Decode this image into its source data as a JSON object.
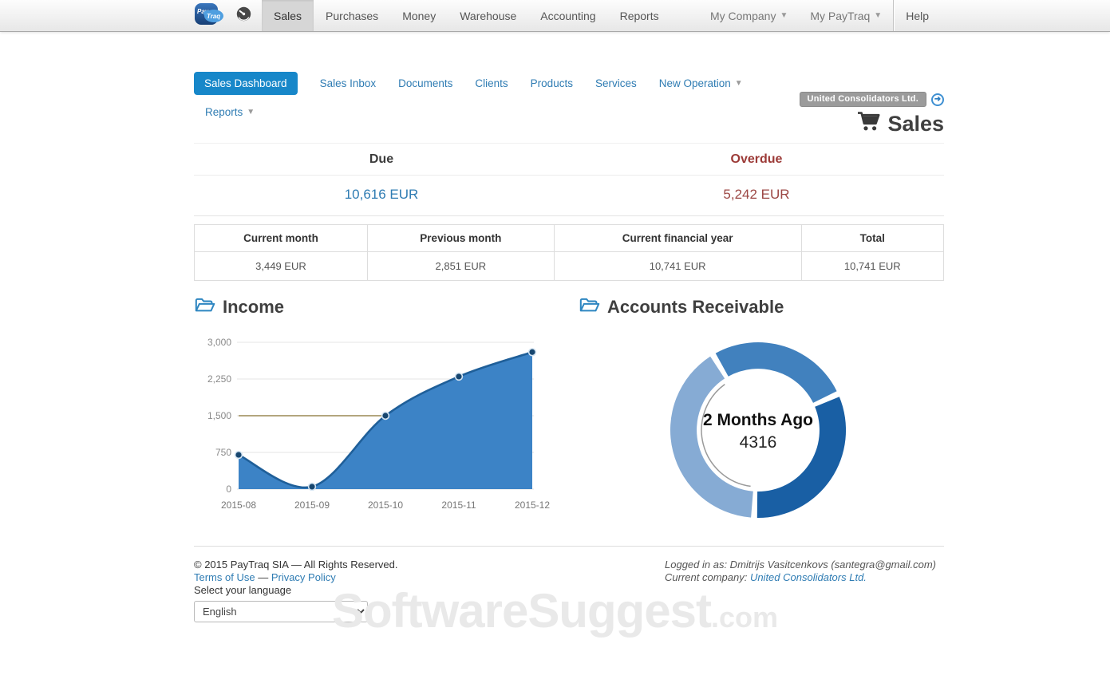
{
  "nav": {
    "brand": "PayTraq",
    "items": [
      {
        "label": "Sales"
      },
      {
        "label": "Purchases"
      },
      {
        "label": "Money"
      },
      {
        "label": "Warehouse"
      },
      {
        "label": "Accounting"
      },
      {
        "label": "Reports"
      }
    ],
    "my_company": "My Company",
    "my_paytraq": "My PayTraq",
    "help": "Help"
  },
  "header": {
    "company_badge": "United Consolidators Ltd.",
    "title": "Sales"
  },
  "tabs": {
    "items": [
      {
        "label": "Sales Dashboard"
      },
      {
        "label": "Sales Inbox"
      },
      {
        "label": "Documents"
      },
      {
        "label": "Clients"
      },
      {
        "label": "Products"
      },
      {
        "label": "Services"
      },
      {
        "label": "New Operation"
      },
      {
        "label": "Reports"
      }
    ]
  },
  "summary": {
    "due_label": "Due",
    "due_value": "10,616 EUR",
    "overdue_label": "Overdue",
    "overdue_value": "5,242 EUR"
  },
  "stats_table": {
    "headers": [
      "Current month",
      "Previous month",
      "Current financial year",
      "Total"
    ],
    "values": [
      "3,449 EUR",
      "2,851 EUR",
      "10,741 EUR",
      "10,741 EUR"
    ]
  },
  "income_section": {
    "title": "Income"
  },
  "receivable_section": {
    "title": "Accounts Receivable"
  },
  "chart_data": [
    {
      "type": "area",
      "title": "Income",
      "x": [
        "2015-08",
        "2015-09",
        "2015-10",
        "2015-11",
        "2015-12"
      ],
      "values": [
        700,
        50,
        1500,
        2300,
        2800
      ],
      "ytick_labels": [
        "0",
        "750",
        "1,500",
        "2,250",
        "3,000"
      ],
      "yticks": [
        0,
        750,
        1500,
        2250,
        3000
      ],
      "ylim": [
        0,
        3000
      ],
      "grid": true,
      "legend": "none",
      "ref_line": {
        "value": 1500,
        "to_index": 2,
        "color": "#b3a67e"
      },
      "colors": {
        "area": "#3c83c6",
        "line": "#1f5f99",
        "marker": "#17466f",
        "marker_ring": "#d4e4f2",
        "grid": "#e6e6e6",
        "tick_text": "#8a8a8a"
      }
    },
    {
      "type": "donut",
      "title": "Accounts Receivable",
      "center_label": "2 Months Ago",
      "center_value": "4316",
      "slices": [
        {
          "value": 2851,
          "color": "#4181be"
        },
        {
          "value": 3449,
          "color": "#195fa4"
        },
        {
          "value": 4316,
          "color": "#86abd4",
          "highlighted": true
        }
      ],
      "start_angle": -31,
      "gap_degrees": 4,
      "highlight_arc_color": "#9a9a9a"
    }
  ],
  "footer": {
    "copyright": "© 2015 PayTraq SIA — All Rights Reserved.",
    "terms": "Terms of Use",
    "separator": " — ",
    "privacy": "Privacy Policy",
    "language_label": "Select your language",
    "language_value": "English",
    "logged_in": "Logged in as: Dmitrijs Vasitcenkovs (santegra@gmail.com)",
    "current_company_label": "Current company: ",
    "current_company": "United Consolidators Ltd."
  },
  "watermark": {
    "text": "SoftwareSuggest",
    "suffix": ".com"
  }
}
